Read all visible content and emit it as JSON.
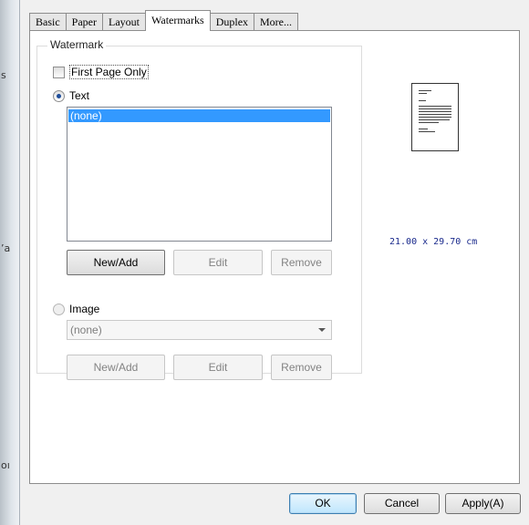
{
  "background_fragments": {
    "left_1": "s",
    "left_2": "’a",
    "left_3": "oı"
  },
  "tabs": [
    {
      "label": "Basic",
      "active": false
    },
    {
      "label": "Paper",
      "active": false
    },
    {
      "label": "Layout",
      "active": false
    },
    {
      "label": "Watermarks",
      "active": true
    },
    {
      "label": "Duplex",
      "active": false
    },
    {
      "label": "More...",
      "active": false
    }
  ],
  "watermark": {
    "group_title": "Watermark",
    "first_page_only": {
      "label": "First Page Only",
      "checked": false
    },
    "text_option": {
      "label": "Text",
      "selected": true
    },
    "text_list": {
      "items": [
        "(none)"
      ],
      "selected_index": 0
    },
    "text_buttons": {
      "new_add": "New/Add",
      "edit": "Edit",
      "remove": "Remove"
    },
    "image_option": {
      "label": "Image",
      "selected": false
    },
    "image_dropdown": {
      "value": "(none)"
    },
    "image_buttons": {
      "new_add": "New/Add",
      "edit": "Edit",
      "remove": "Remove"
    }
  },
  "preview": {
    "paper_size": "21.00 x 29.70 cm"
  },
  "footer": {
    "ok": "OK",
    "cancel": "Cancel",
    "apply": "Apply(A)"
  },
  "colors": {
    "selection": "#3399ff",
    "ok_border": "#3c7fb1",
    "paper_size_text": "#1a2a8c"
  }
}
